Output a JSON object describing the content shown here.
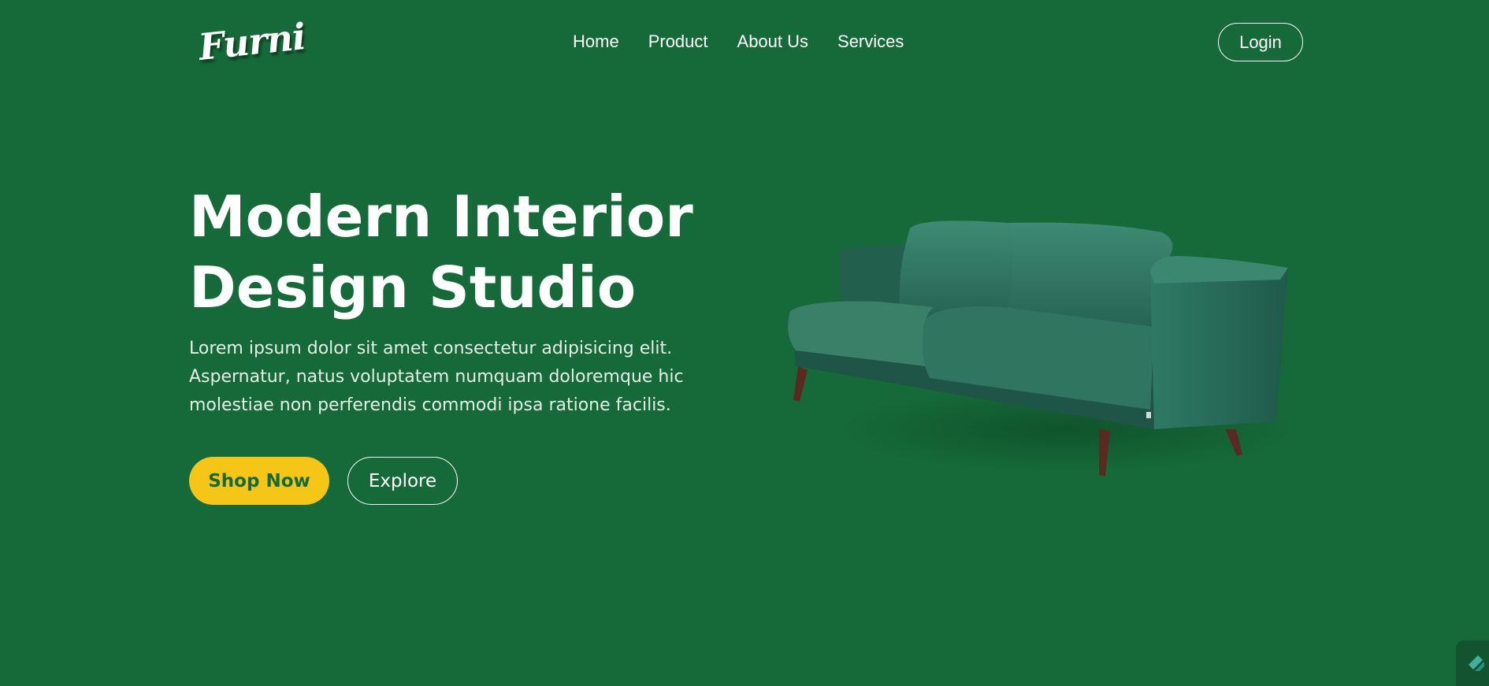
{
  "header": {
    "logo_text": "Furni",
    "nav": [
      {
        "label": "Home"
      },
      {
        "label": "Product"
      },
      {
        "label": "About Us"
      },
      {
        "label": "Services"
      }
    ],
    "login_label": "Login"
  },
  "hero": {
    "title_line1": "Modern Interior",
    "title_line2": "Design Studio",
    "description": "Lorem ipsum dolor sit amet consectetur adipisicing elit. Aspernatur, natus voluptatem numquam doloremque hic molestiae non perferendis commodi ipsa ratione facilis.",
    "shop_label": "Shop Now",
    "explore_label": "Explore",
    "image_icon": "sofa-image"
  },
  "colors": {
    "background": "#166a39",
    "accent": "#f5c518",
    "text": "#ffffff"
  },
  "corner_widget_icon": "widget-icon"
}
